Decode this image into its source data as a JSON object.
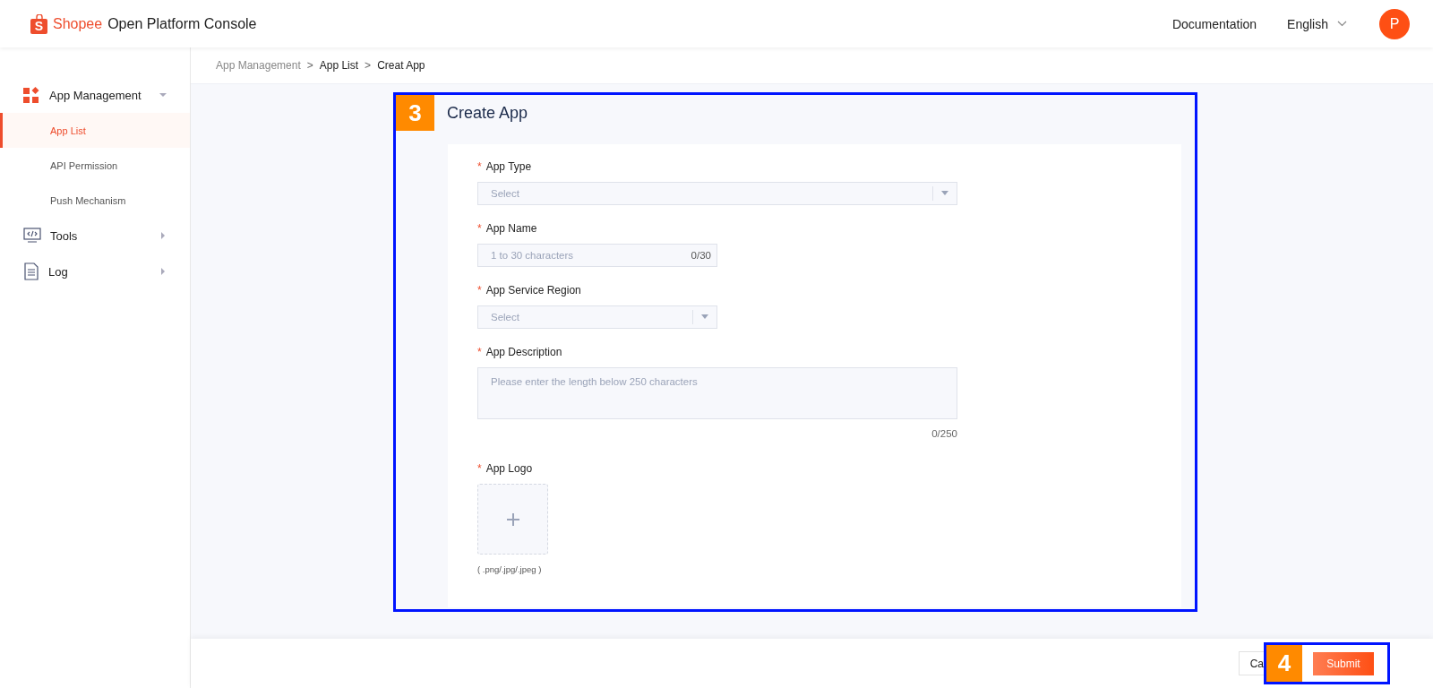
{
  "header": {
    "logo_letter": "S",
    "brand": "Shopee",
    "title": "Open Platform Console",
    "nav": [
      "Documentation"
    ],
    "language": "English",
    "avatar": "P"
  },
  "sidebar": {
    "items": [
      {
        "label": "App Management",
        "expanded": true,
        "children": [
          {
            "label": "App List",
            "selected": true
          },
          {
            "label": "API Permission",
            "selected": false
          },
          {
            "label": "Push Mechanism",
            "selected": false
          }
        ]
      },
      {
        "label": "Tools",
        "expanded": false
      },
      {
        "label": "Log",
        "expanded": false
      }
    ]
  },
  "breadcrumb": {
    "items": [
      {
        "label": "App Management",
        "current": false
      },
      {
        "label": "App List",
        "current": true
      },
      {
        "label": "Creat App",
        "current": true
      }
    ],
    "separators": [
      ">",
      ">"
    ]
  },
  "form": {
    "step": "3",
    "title": "Create App",
    "fields": [
      {
        "kind": "select",
        "label": "App Type",
        "required_mark": "*",
        "placeholder": "Select"
      },
      {
        "kind": "text",
        "label": "App Name",
        "required_mark": "*",
        "placeholder": "1 to 30 characters",
        "counter": "0/30"
      },
      {
        "kind": "select",
        "label": "App Service Region",
        "required_mark": "*",
        "placeholder": "Select"
      },
      {
        "kind": "textarea",
        "label": "App Description",
        "required_mark": "*",
        "placeholder": "Please enter the length below 250 characters",
        "counter": "0/250"
      },
      {
        "kind": "upload",
        "label": "App Logo",
        "required_mark": "*",
        "hint": "( .png/.jpg/.jpeg )"
      }
    ]
  },
  "footer": {
    "cancel": "Ca",
    "step": "4",
    "submit": "Submit"
  }
}
